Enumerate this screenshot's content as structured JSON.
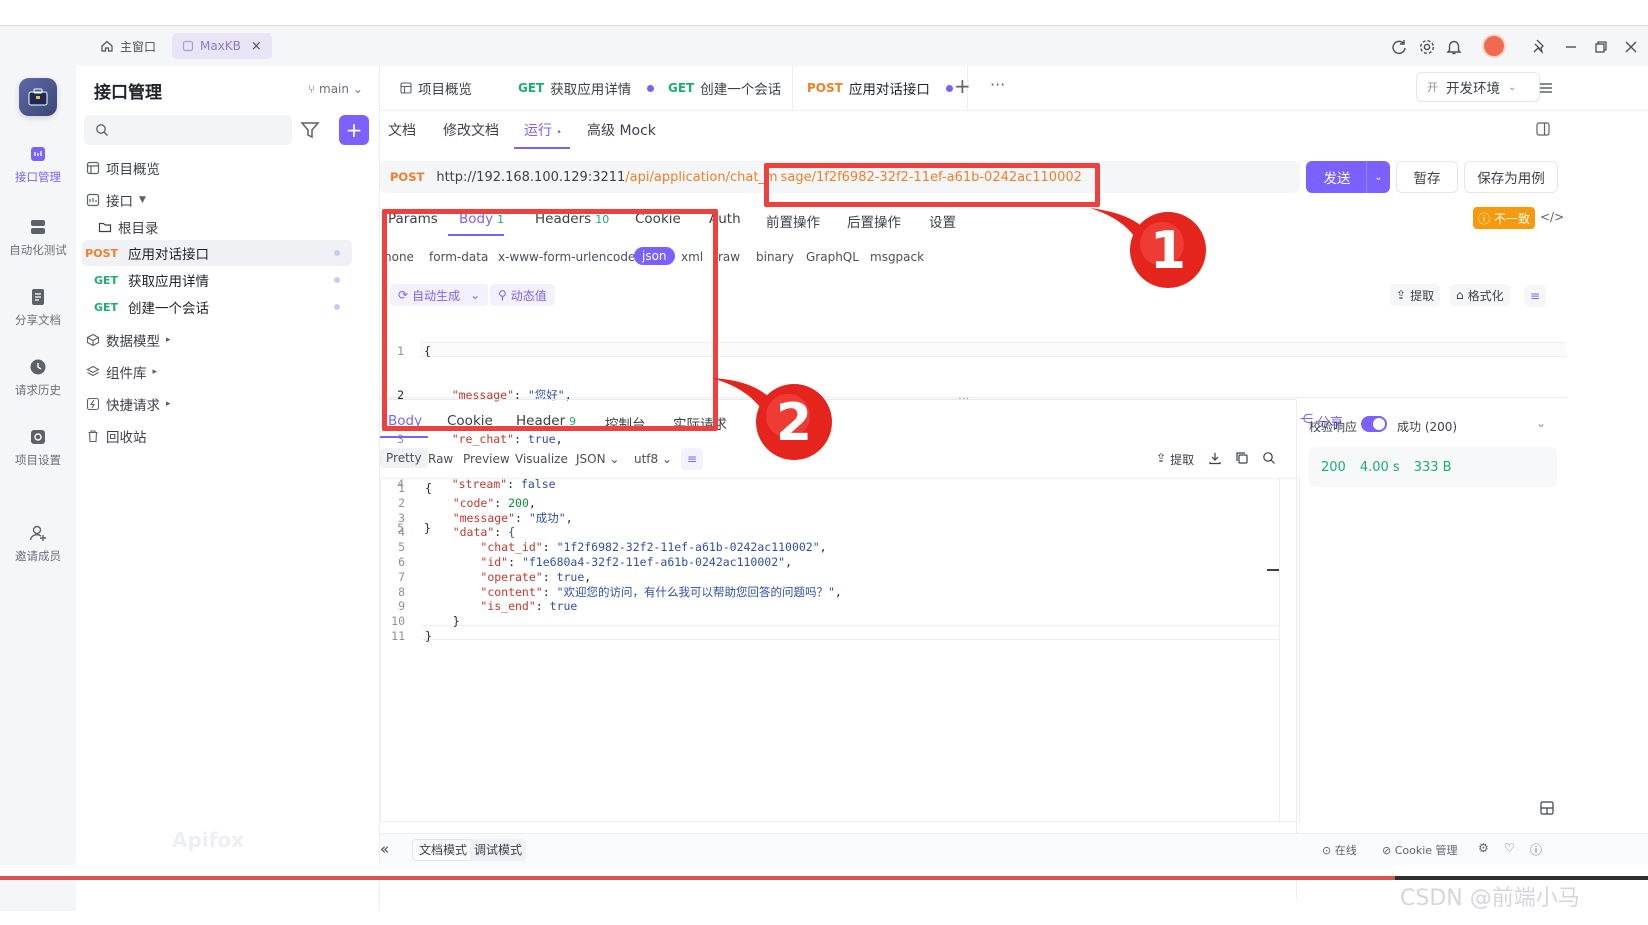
{
  "window_tabs": {
    "home": "主窗口",
    "app": "MaxKB"
  },
  "rail": {
    "items": [
      {
        "label": "接口管理"
      },
      {
        "label": "自动化测试"
      },
      {
        "label": "分享文档"
      },
      {
        "label": "请求历史"
      },
      {
        "label": "项目设置"
      },
      {
        "label": "邀请成员"
      }
    ]
  },
  "sidebar": {
    "title": "接口管理",
    "branch": "main",
    "overview": "项目概览",
    "api_group": "接口",
    "root": "根目录",
    "apis": [
      {
        "method": "POST",
        "name": "应用对话接口"
      },
      {
        "method": "GET",
        "name": "获取应用详情"
      },
      {
        "method": "GET",
        "name": "创建一个会话"
      }
    ],
    "sections": [
      "数据模型",
      "组件库",
      "快捷请求",
      "回收站"
    ],
    "brand": "Apifox"
  },
  "tabs": [
    {
      "method": "",
      "label": "项目概览"
    },
    {
      "method": "GET",
      "label": "获取应用详情"
    },
    {
      "method": "GET",
      "label": "创建一个会话"
    },
    {
      "method": "POST",
      "label": "应用对话接口"
    }
  ],
  "env": {
    "badge": "开",
    "label": "开发环境"
  },
  "subtabs": [
    "文档",
    "修改文档",
    "运行",
    "高级 Mock"
  ],
  "request": {
    "method": "POST",
    "url_host": "http://192.168.100.129:3211",
    "url_path": "/api/application/chat_m",
    "url_tail": "sage/1f2f6982-32f2-11ef-a61b-0242ac110002",
    "send": "发送",
    "save_temp": "暂存",
    "save_case": "保存为用例"
  },
  "param_tabs": [
    {
      "label": "Params",
      "count": ""
    },
    {
      "label": "Body",
      "count": "1"
    },
    {
      "label": "Headers",
      "count": "10"
    },
    {
      "label": "Cookie",
      "count": ""
    },
    {
      "label": "Auth",
      "count": ""
    },
    {
      "label": "前置操作",
      "count": ""
    },
    {
      "label": "后置操作",
      "count": ""
    },
    {
      "label": "设置",
      "count": ""
    }
  ],
  "inconsistent": "不一致",
  "body_types": [
    "none",
    "form-data",
    "x-www-form-urlencoded",
    "json",
    "xml",
    "raw",
    "binary",
    "GraphQL",
    "msgpack"
  ],
  "body_tools": {
    "auto": "自动生成",
    "dynamic": "动态值",
    "extract": "提取",
    "format": "格式化"
  },
  "request_body": [
    {
      "n": "1",
      "text": "{"
    },
    {
      "n": "2",
      "key": "\"message\"",
      "val": "\"您好\"",
      "tail": ","
    },
    {
      "n": "3",
      "key": "\"re_chat\"",
      "val": "true",
      "tail": ","
    },
    {
      "n": "4",
      "key": "\"stream\"",
      "val": "false",
      "tail": ""
    },
    {
      "n": "5",
      "text": "}"
    }
  ],
  "response_tabs": [
    {
      "label": "Body",
      "count": ""
    },
    {
      "label": "Cookie",
      "count": ""
    },
    {
      "label": "Header",
      "count": "9"
    },
    {
      "label": "控制台",
      "count": ""
    },
    {
      "label": "实际请求",
      "count": ""
    }
  ],
  "share": "分享",
  "view_tabs": [
    "Pretty",
    "Raw",
    "Preview",
    "Visualize",
    "JSON",
    "utf8"
  ],
  "resp_tools": {
    "extract": "提取"
  },
  "validate": {
    "label": "校验响应",
    "result": "成功 (200)"
  },
  "status": {
    "code": "200",
    "time": "4.00 s",
    "size": "333 B"
  },
  "response_body": [
    {
      "n": "1",
      "indent": 0,
      "text": "{"
    },
    {
      "n": "2",
      "indent": 1,
      "key": "\"code\"",
      "val": "200",
      "tail": ","
    },
    {
      "n": "3",
      "indent": 1,
      "key": "\"message\"",
      "val": "\"成功\"",
      "tail": ","
    },
    {
      "n": "4",
      "indent": 1,
      "key": "\"data\"",
      "val": "{",
      "tail": ""
    },
    {
      "n": "5",
      "indent": 2,
      "key": "\"chat_id\"",
      "val": "\"1f2f6982-32f2-11ef-a61b-0242ac110002\"",
      "tail": ","
    },
    {
      "n": "6",
      "indent": 2,
      "key": "\"id\"",
      "val": "\"f1e680a4-32f2-11ef-a61b-0242ac110002\"",
      "tail": ","
    },
    {
      "n": "7",
      "indent": 2,
      "key": "\"operate\"",
      "val": "true",
      "tail": ","
    },
    {
      "n": "8",
      "indent": 2,
      "key": "\"content\"",
      "val": "\"欢迎您的访问，有什么我可以帮助您回答的问题吗？\"",
      "tail": ","
    },
    {
      "n": "9",
      "indent": 2,
      "key": "\"is_end\"",
      "val": "true",
      "tail": ""
    },
    {
      "n": "10",
      "indent": 1,
      "text": "}"
    },
    {
      "n": "11",
      "indent": 0,
      "text": "}"
    }
  ],
  "bottom": {
    "doc_mode": "文档模式",
    "debug_mode": "调试模式",
    "online": "在线",
    "cookie": "Cookie 管理"
  },
  "annotations": {
    "one": "1",
    "two": "2"
  },
  "watermark": "CSDN @前端小马",
  "colors": {
    "accent": "#7b61ff",
    "annotation": "#ef4040",
    "post": "#f07f2a",
    "get": "#1cae6f"
  }
}
